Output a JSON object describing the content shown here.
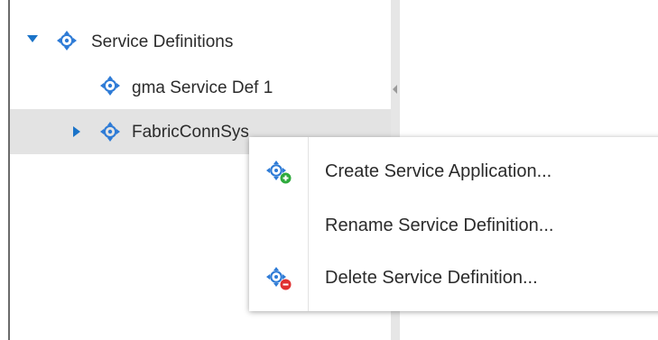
{
  "tree": {
    "root": {
      "label": "Service Definitions",
      "expanded": true,
      "icon": "service-definition-icon"
    },
    "items": [
      {
        "label": "gma Service Def 1",
        "icon": "service-definition-icon",
        "selected": false
      },
      {
        "label": "FabricConnSys",
        "icon": "service-definition-icon",
        "selected": true,
        "collapsed": true
      }
    ]
  },
  "context_menu": {
    "items": [
      {
        "label": "Create Service Application...",
        "icon": "create-service-application-icon"
      },
      {
        "label": "Rename Service Definition...",
        "icon": ""
      },
      {
        "label": "Delete Service Definition...",
        "icon": "delete-service-definition-icon"
      }
    ]
  },
  "colors": {
    "icon_blue": "#2e7bd6",
    "expander_blue": "#1a73c8",
    "selected_row": "#e3e3e3",
    "add_badge": "#2eaa3c",
    "delete_badge": "#e03030"
  }
}
